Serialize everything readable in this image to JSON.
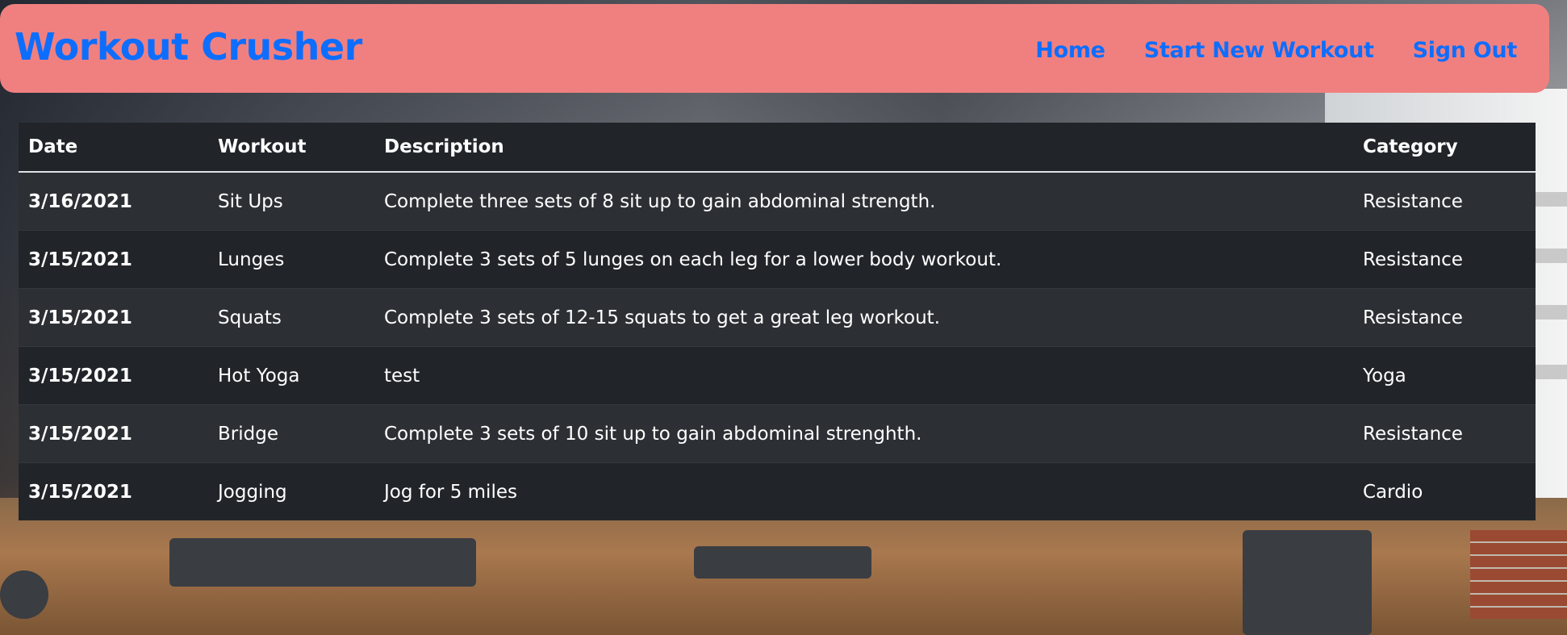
{
  "app": {
    "brand": "Workout Crusher"
  },
  "nav": {
    "links": [
      "Home",
      "Start New Workout",
      "Sign Out"
    ]
  },
  "table": {
    "headers": [
      "Date",
      "Workout",
      "Description",
      "Category"
    ],
    "rows": [
      {
        "date": "3/16/2021",
        "workout": "Sit Ups",
        "description": "Complete three sets of 8 sit up to gain abdominal strength.",
        "category": "Resistance"
      },
      {
        "date": "3/15/2021",
        "workout": "Lunges",
        "description": "Complete 3 sets of 5 lunges on each leg for a lower body workout.",
        "category": "Resistance"
      },
      {
        "date": "3/15/2021",
        "workout": "Squats",
        "description": "Complete 3 sets of 12-15 squats to get a great leg workout.",
        "category": "Resistance"
      },
      {
        "date": "3/15/2021",
        "workout": "Hot Yoga",
        "description": "test",
        "category": "Yoga"
      },
      {
        "date": "3/15/2021",
        "workout": "Bridge",
        "description": "Complete 3 sets of 10 sit up to gain abdominal strenghth.",
        "category": "Resistance"
      },
      {
        "date": "3/15/2021",
        "workout": "Jogging",
        "description": "Jog for 5 miles",
        "category": "Cardio"
      }
    ]
  },
  "colors": {
    "navbar": "#f08080",
    "link": "#0d6efd",
    "table_dark": "#212529",
    "table_stripe": "#2c3034"
  }
}
